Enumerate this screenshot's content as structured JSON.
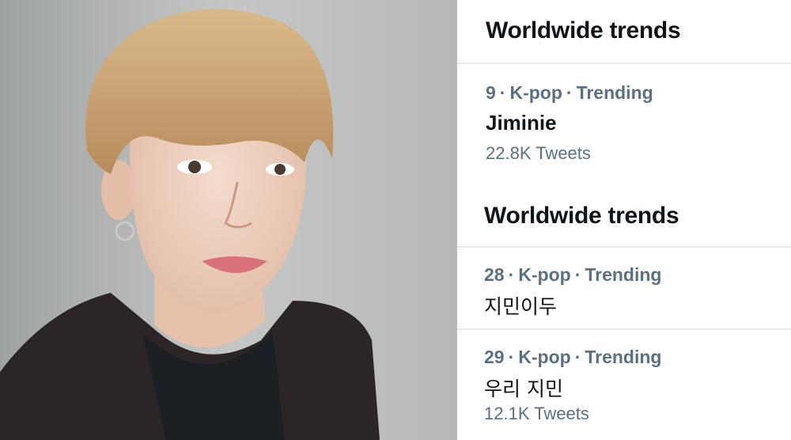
{
  "photo": {
    "subject": "avatar"
  },
  "trends_panel": {
    "sections": [
      {
        "header": "Worldwide trends",
        "item": {
          "rank": "9",
          "category": "K-pop",
          "status": "Trending",
          "name": "Jiminie",
          "tweet_count": "22.8K Tweets"
        }
      },
      {
        "header": "Worldwide trends",
        "items": [
          {
            "rank": "28",
            "category": "K-pop",
            "status": "Trending",
            "name": "지민이두"
          },
          {
            "rank": "29",
            "category": "K-pop",
            "status": "Trending",
            "name": "우리 지민",
            "tweet_count": "12.1K Tweets"
          }
        ]
      }
    ],
    "separator": "·"
  },
  "colors": {
    "heading": "#0f1419",
    "secondary": "#5b7083",
    "divider": "#e6e9ec",
    "background": "#ffffff"
  }
}
